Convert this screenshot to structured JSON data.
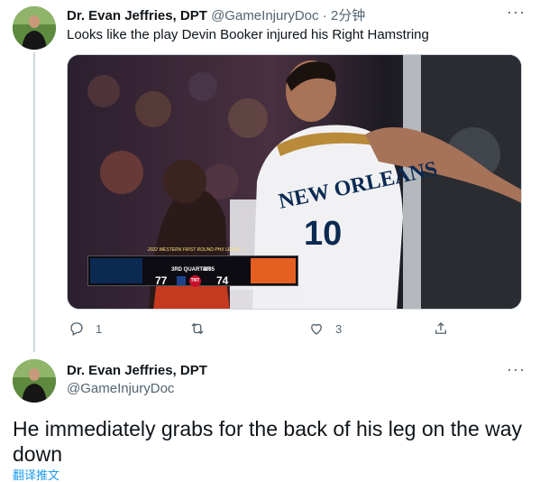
{
  "tweet1": {
    "author_name": "Dr. Evan Jeffries, DPT",
    "handle": "@GameInjuryDoc",
    "separator": "·",
    "time": "2分钟",
    "text": "Looks like the play Devin Booker injured his Right Hamstring",
    "media": {
      "jersey_team": "NEW ORLEANS",
      "jersey_number": "10",
      "scorebug": {
        "title": "2022 WESTERN FIRST ROUND   PHX LEADS 1-0",
        "quarter": "3RD QUARTER",
        "clock": "4:35",
        "home_score": "77",
        "away_score": "74",
        "network": "TNT"
      }
    },
    "actions": {
      "reply_count": "1",
      "retweet_count": "",
      "like_count": "3"
    }
  },
  "tweet2": {
    "author_name": "Dr. Evan Jeffries, DPT",
    "handle": "@GameInjuryDoc",
    "text": "He immediately grabs for the back of his leg on the way down",
    "translate_label": "翻译推文"
  },
  "colors": {
    "text_primary": "#0f1419",
    "text_secondary": "#536471",
    "link": "#1d9bf0",
    "divider": "#cfd9de"
  },
  "icons": {
    "more": "more-horizontal-icon",
    "reply": "reply-icon",
    "retweet": "retweet-icon",
    "like": "heart-icon",
    "share": "share-icon"
  }
}
